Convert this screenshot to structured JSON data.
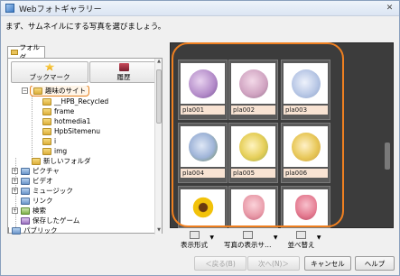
{
  "window": {
    "title": "Webフォトギャラリー",
    "close": "✕"
  },
  "instruction": "まず、サムネイルにする写真を選びましょう。",
  "left_panel": {
    "tab_label": "フォルダ",
    "bookmark_label": "ブックマーク",
    "history_label": "履歴",
    "tree": [
      {
        "label": "趣味のサイト",
        "expander": "−",
        "icon": "folder",
        "selected": true
      },
      {
        "label": "__HPB_Recycled",
        "icon": "folder"
      },
      {
        "label": "frame",
        "icon": "folder"
      },
      {
        "label": "hotmedia1",
        "icon": "folder"
      },
      {
        "label": "HpbSitemenu",
        "icon": "folder"
      },
      {
        "label": "i",
        "icon": "folder"
      },
      {
        "label": "img",
        "icon": "folder"
      },
      {
        "label": "新しいフォルダ",
        "icon": "folder"
      },
      {
        "label": "ピクチャ",
        "expander": "+",
        "icon": "blue"
      },
      {
        "label": "ビデオ",
        "expander": "+",
        "icon": "blue"
      },
      {
        "label": "ミュージック",
        "expander": "+",
        "icon": "blue"
      },
      {
        "label": "リンク",
        "icon": "blue"
      },
      {
        "label": "検索",
        "expander": "+",
        "icon": "green"
      },
      {
        "label": "保存したゲーム",
        "icon": "purple"
      },
      {
        "label": "パブリック",
        "expander": "+",
        "icon": "blue"
      }
    ]
  },
  "thumbnails": [
    {
      "name": "pla001",
      "color": "#b28ac8"
    },
    {
      "name": "pla002",
      "color": "#cfa2c0"
    },
    {
      "name": "pla003",
      "color": "#b9c8e6"
    },
    {
      "name": "pla004",
      "color": "#9fb4d8"
    },
    {
      "name": "pla005",
      "color": "#e6cf5a"
    },
    {
      "name": "pla006",
      "color": "#e8c85a"
    },
    {
      "name": "",
      "color": "#f2c20a"
    },
    {
      "name": "",
      "color": "#e89aa8"
    },
    {
      "name": "",
      "color": "#e47a90"
    }
  ],
  "toolbar": {
    "view_label": "表示形式",
    "photo_view_label": "写真の表示サ…",
    "sort_label": "並べ替え"
  },
  "buttons": {
    "back": "＜戻る(B)",
    "next": "次へ(N)＞",
    "cancel": "キャンセル",
    "help": "ヘルプ"
  },
  "colors": {
    "highlight": "#f08020",
    "caption_bg": "#f8e3d3",
    "grid_bg": "#3c3c3c"
  }
}
